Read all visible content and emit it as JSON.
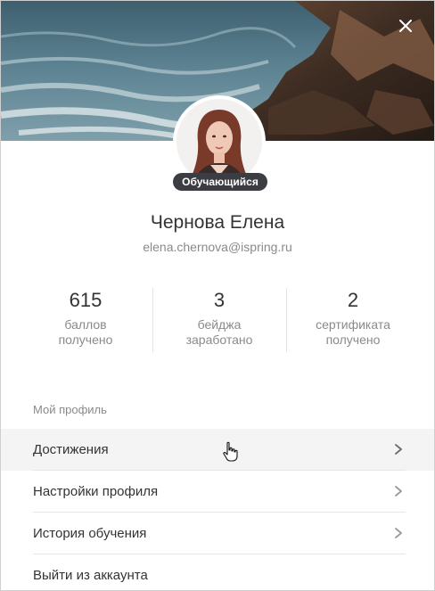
{
  "close_icon": "close-icon",
  "profile": {
    "role_badge": "Обучающийся",
    "name": "Чернова Елена",
    "email": "elena.chernova@ispring.ru"
  },
  "stats": [
    {
      "value": "615",
      "label": "баллов\nполучено"
    },
    {
      "value": "3",
      "label": "бейджа\nзаработано"
    },
    {
      "value": "2",
      "label": "сертификата\nполучено"
    }
  ],
  "menu": {
    "section_title": "Мой профиль",
    "items": [
      {
        "label": "Достижения",
        "has_chevron": true,
        "state": "hover"
      },
      {
        "label": "Настройки профиля",
        "has_chevron": true
      },
      {
        "label": "История обучения",
        "has_chevron": true
      },
      {
        "label": "Выйти из аккаунта",
        "has_chevron": false
      }
    ]
  },
  "colors": {
    "text_primary": "#333333",
    "text_secondary": "#8a8a8a",
    "badge_bg": "#3b3d42",
    "hover_bg": "#f4f4f4",
    "chevron": "#6b6b6b"
  }
}
